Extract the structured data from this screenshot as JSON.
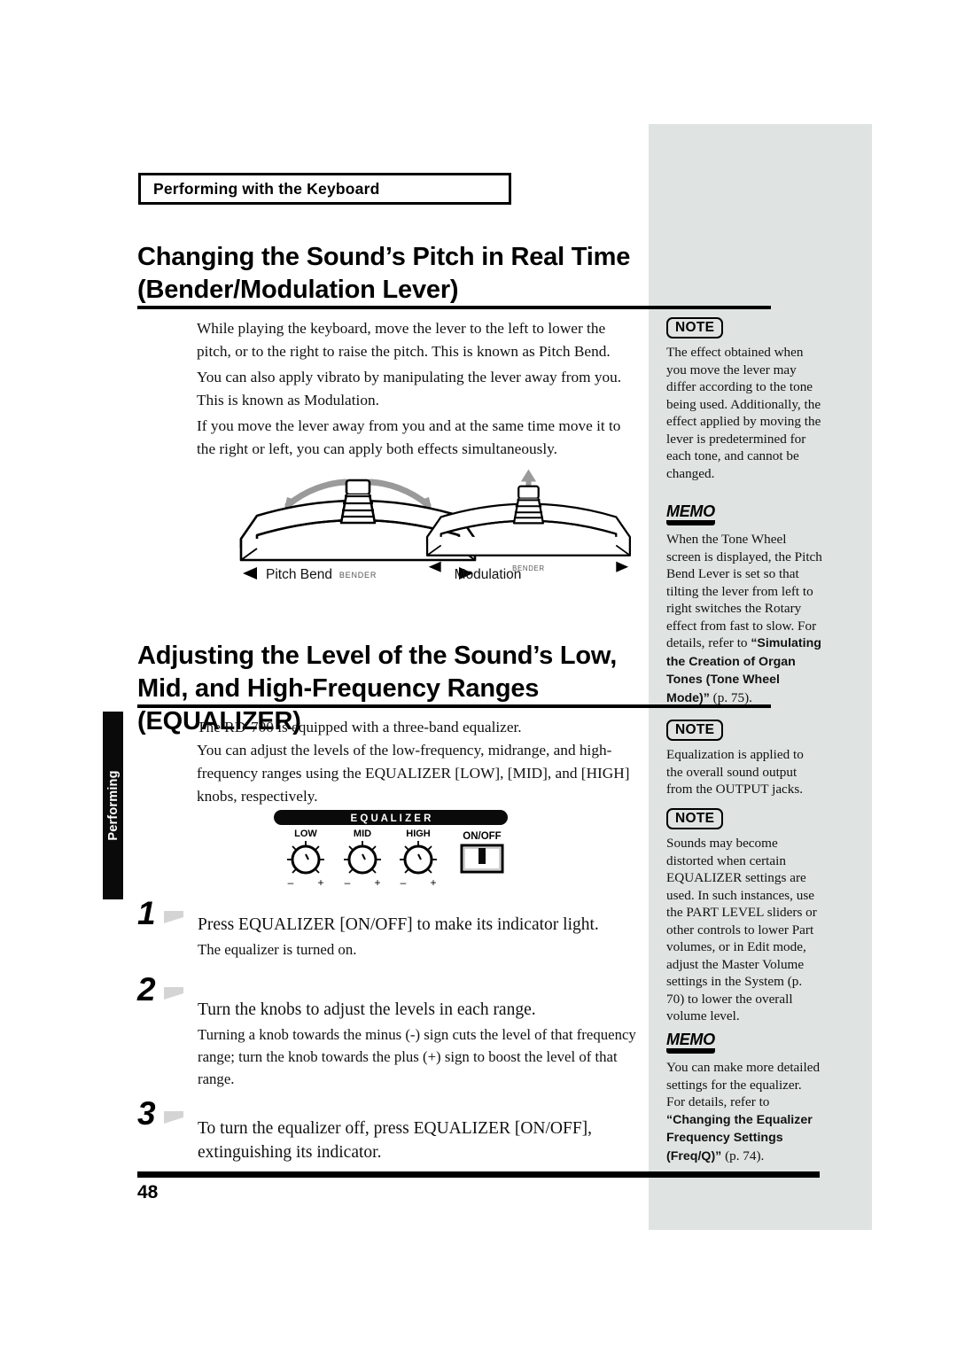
{
  "document": {
    "running_head": "Performing with the Keyboard",
    "page_number": "48",
    "thumb_tab": "Performing"
  },
  "sections": [
    {
      "title": "Changing the Sound’s Pitch in Real Time (Bender/Modulation Lever)",
      "paragraphs": [
        "While playing the keyboard, move the lever to the left to lower the pitch, or to the right to raise the pitch. This is known as Pitch Bend.",
        "You can also apply vibrato by manipulating the lever away from you. This is known as Modulation.",
        "If you move the lever away from you and at the same time move it to the right or left, you can apply both effects simultaneously."
      ]
    },
    {
      "title": "Adjusting the Level of the Sound’s Low, Mid, and High-Frequency Ranges (EQUALIZER)",
      "paragraphs": [
        "The RD-700 is equipped with a three-band equalizer.",
        "You can adjust the levels of the low-frequency, midrange, and high-frequency ranges using the EQUALIZER [LOW], [MID], and [HIGH] knobs, respectively."
      ]
    }
  ],
  "lever_figure": {
    "left_caption": "Pitch Bend",
    "right_caption": "Modulation",
    "lever_label": "BENDER"
  },
  "eq_figure": {
    "panel_label": "E Q U A L I Z E R",
    "knobs": [
      "LOW",
      "MID",
      "HIGH"
    ],
    "switch_label": "ON/OFF",
    "minus_sign": "–",
    "plus_sign": "+"
  },
  "steps": [
    {
      "number": "1",
      "lead": "Press EQUALIZER [ON/OFF] to make its indicator light.",
      "sub": "The equalizer is turned on."
    },
    {
      "number": "2",
      "lead": "Turn the knobs to adjust the levels in each range.",
      "sub": "Turning a knob towards the minus (-) sign cuts the level of that frequency range; turn the knob towards the plus (+) sign to boost the level of that range."
    },
    {
      "number": "3",
      "lead": "To turn the equalizer off, press EQUALIZER [ON/OFF], extinguishing its indicator.",
      "sub": ""
    }
  ],
  "side_notes": [
    {
      "badge": "NOTE",
      "kind": "note",
      "text": "The effect obtained when you move the lever may differ according to the tone being used. Additionally, the effect applied by moving the lever is predetermined for each tone, and cannot be changed."
    },
    {
      "badge": "MEMO",
      "kind": "memo",
      "text_plain": "When the Tone Wheel screen is displayed, the Pitch Bend Lever is set so that tilting the lever from left to right switches the Rotary effect from fast to slow. For details, refer to ",
      "text_bold": "“Simulating the Creation of Organ Tones (Tone Wheel Mode)”",
      "text_tail": " (p. 75)."
    },
    {
      "badge": "NOTE",
      "kind": "note",
      "text": "Equalization is applied to the overall sound output from the OUTPUT jacks."
    },
    {
      "badge": "NOTE",
      "kind": "note",
      "text": "Sounds may become distorted when certain EQUALIZER settings are used. In such instances, use the PART LEVEL sliders or other controls to lower Part volumes, or in Edit mode, adjust the Master Volume settings in the System (p. 70) to lower the overall volume level."
    },
    {
      "badge": "MEMO",
      "kind": "memo",
      "text_plain": "You can make more detailed settings for the equalizer. For details, refer to ",
      "text_bold": "“Changing the Equalizer Frequency Settings (Freq/Q)”",
      "text_tail": " (p. 74)."
    }
  ],
  "colors": {
    "sidebar_gray": "#dfe3e2",
    "rule_black": "#000000",
    "arrow_gray": "#9a9a9a",
    "tab_black": "#0a0a0a"
  }
}
